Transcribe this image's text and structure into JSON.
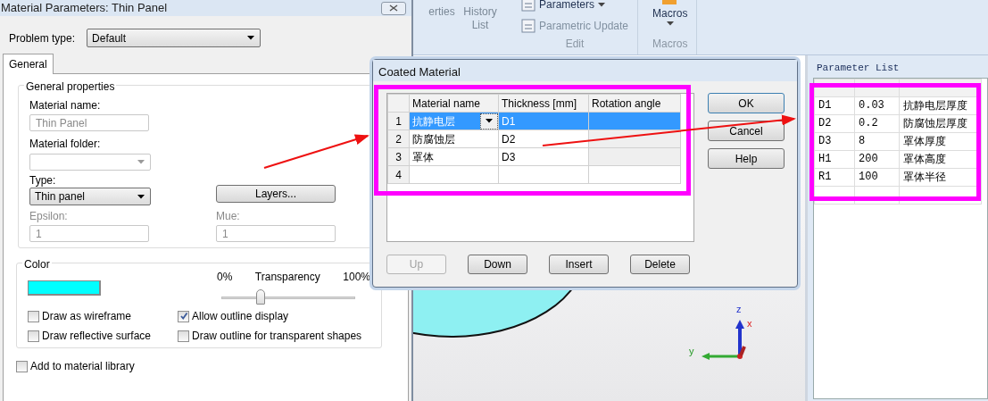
{
  "ribbon": {
    "items": [
      {
        "label": "erties"
      },
      {
        "label": "History List"
      }
    ],
    "edit_items": [
      {
        "label": "Parameters"
      },
      {
        "label": "Parametric Update"
      }
    ],
    "groups": [
      {
        "label": "Edit"
      },
      {
        "label": "Macros"
      }
    ],
    "macros": {
      "label": "Macros"
    }
  },
  "material_dialog": {
    "title": "Material Parameters: Thin Panel",
    "problem_type": {
      "label": "Problem type:",
      "value": "Default"
    },
    "tabs": [
      {
        "label": "General",
        "selected": true
      }
    ],
    "general": {
      "legend": "General properties",
      "material_name": {
        "label": "Material name:",
        "value": "Thin Panel",
        "disabled": true
      },
      "material_folder": {
        "label": "Material folder:"
      },
      "type": {
        "label": "Type:",
        "value": "Thin panel"
      },
      "layers_button": "Layers...",
      "epsilon": {
        "label": "Epsilon:",
        "value": "1",
        "disabled": true
      },
      "mue": {
        "label": "Mue:",
        "value": "1",
        "disabled": true
      }
    },
    "color": {
      "legend": "Color",
      "swatch": {
        "color": "#00ffff"
      },
      "min_label": "0%",
      "label": "Transparency",
      "max_label": "100%",
      "level": 0.29,
      "checkboxes": [
        {
          "label": "Draw as wireframe",
          "checked": false
        },
        {
          "label": "Allow outline display",
          "checked": true
        },
        {
          "label": "Draw reflective surface",
          "checked": false
        },
        {
          "label": "Draw outline for transparent shapes",
          "checked": false
        }
      ]
    },
    "add_to_library": {
      "label": "Add to material library",
      "checked": false
    }
  },
  "coated_dialog": {
    "title": "Coated Material",
    "columns": [
      "Material name",
      "Thickness [mm]",
      "Rotation angle"
    ],
    "rows": [
      {
        "number": "1",
        "material": "抗静电层",
        "thickness": "D1",
        "selected": true
      },
      {
        "number": "2",
        "material": "防腐蚀层",
        "thickness": "D2",
        "selected": false
      },
      {
        "number": "3",
        "material": "罩体",
        "thickness": "D3",
        "selected": false
      },
      {
        "number": "4",
        "selected": false
      }
    ],
    "side_buttons": [
      {
        "label": "OK",
        "disabled": false
      },
      {
        "label": "Cancel",
        "disabled": false
      },
      {
        "label": "Help",
        "disabled": false
      }
    ],
    "bottom_buttons": [
      {
        "label": "Up",
        "disabled": true
      },
      {
        "label": "Down",
        "disabled": false
      },
      {
        "label": "Insert",
        "disabled": false
      },
      {
        "label": "Delete",
        "disabled": false
      }
    ]
  },
  "parameter_list": {
    "title": "Parameter List",
    "rows": [
      {
        "name": "D1",
        "value": "0.03",
        "description": "抗静电层厚度"
      },
      {
        "name": "D2",
        "value": "0.2",
        "description": "防腐蚀层厚度"
      },
      {
        "name": "D3",
        "value": "8",
        "description": "罩体厚度"
      },
      {
        "name": "H1",
        "value": "200",
        "description": "罩体高度"
      },
      {
        "name": "R1",
        "value": "100",
        "description": "罩体半径"
      }
    ]
  },
  "viewport": {
    "axes": {
      "z": "z",
      "x": "x",
      "y": "y"
    }
  }
}
